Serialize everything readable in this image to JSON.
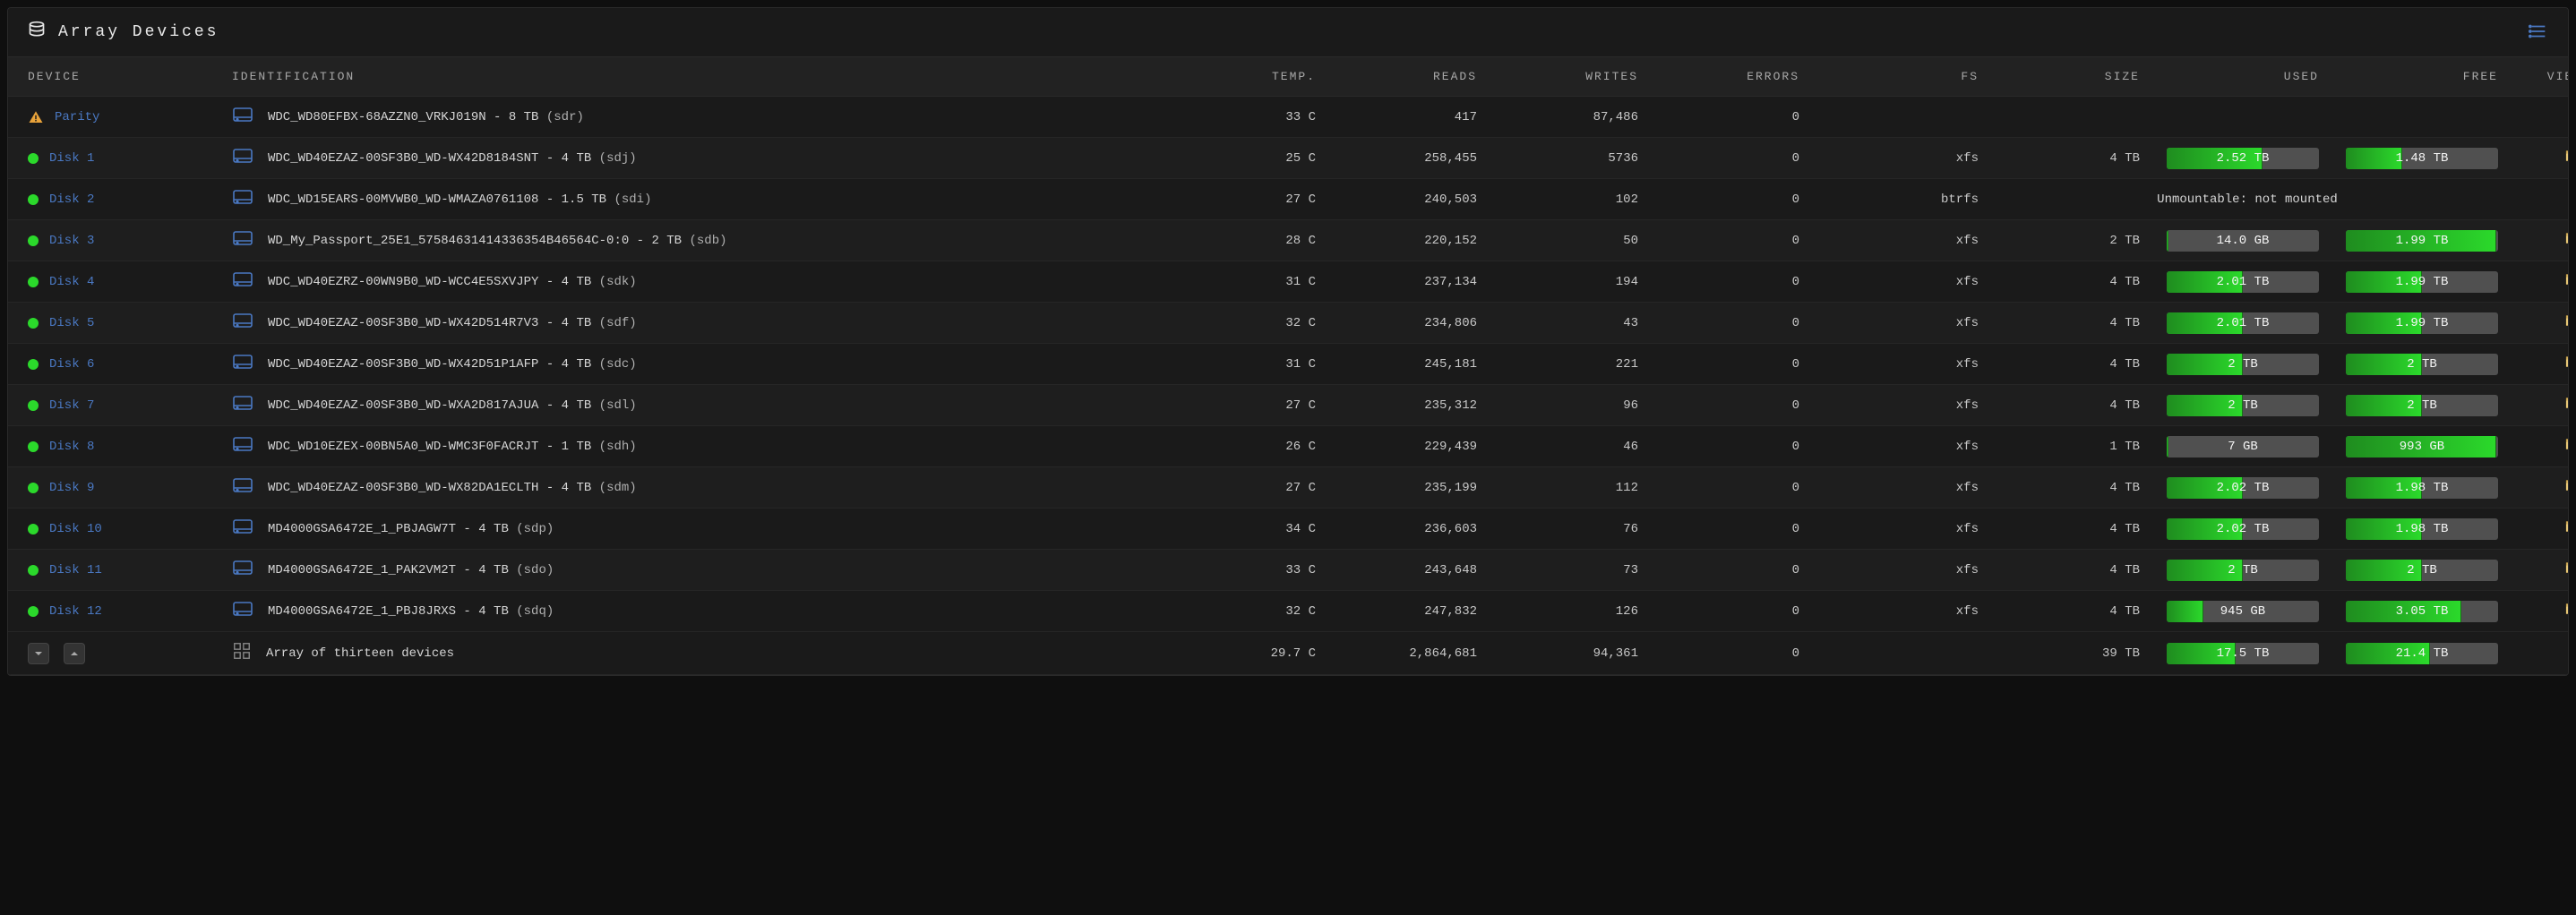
{
  "panel": {
    "title": "Array Devices"
  },
  "columns": {
    "device": "DEVICE",
    "identification": "IDENTIFICATION",
    "temp": "TEMP.",
    "reads": "READS",
    "writes": "WRITES",
    "errors": "ERRORS",
    "fs": "FS",
    "size": "SIZE",
    "used": "USED",
    "free": "FREE",
    "view": "VIEW"
  },
  "devices": [
    {
      "status": "warn",
      "name": "Parity",
      "ident": "WDC_WD80EFBX-68AZZN0_VRKJ019N",
      "cap": "8 TB",
      "node": "(sdr)",
      "temp": "33 C",
      "reads": "417",
      "writes": "87,486",
      "errors": "0",
      "fs": "",
      "size": "",
      "used": null,
      "free": null,
      "view": false,
      "unmountable": false
    },
    {
      "status": "ok",
      "name": "Disk 1",
      "ident": "WDC_WD40EZAZ-00SF3B0_WD-WX42D8184SNT",
      "cap": "4 TB",
      "node": "(sdj)",
      "temp": "25 C",
      "reads": "258,455",
      "writes": "5736",
      "errors": "0",
      "fs": "xfs",
      "size": "4 TB",
      "used": {
        "label": "2.52 TB",
        "pct": 63
      },
      "free": {
        "label": "1.48 TB",
        "pct": 37
      },
      "view": true,
      "unmountable": false
    },
    {
      "status": "ok",
      "name": "Disk 2",
      "ident": "WDC_WD15EARS-00MVWB0_WD-WMAZA0761108",
      "cap": "1.5 TB",
      "node": "(sdi)",
      "temp": "27 C",
      "reads": "240,503",
      "writes": "102",
      "errors": "0",
      "fs": "btrfs",
      "size": "",
      "used": null,
      "free": null,
      "view": false,
      "unmountable": true,
      "unmountable_text": "Unmountable: not mounted"
    },
    {
      "status": "ok",
      "name": "Disk 3",
      "ident": "WD_My_Passport_25E1_57584631414336354B46564C-0:0",
      "cap": "2 TB",
      "node": "(sdb)",
      "temp": "28 C",
      "reads": "220,152",
      "writes": "50",
      "errors": "0",
      "fs": "xfs",
      "size": "2 TB",
      "used": {
        "label": "14.0 GB",
        "pct": 1
      },
      "free": {
        "label": "1.99 TB",
        "pct": 99
      },
      "view": true,
      "unmountable": false
    },
    {
      "status": "ok",
      "name": "Disk 4",
      "ident": "WDC_WD40EZRZ-00WN9B0_WD-WCC4E5SXVJPY",
      "cap": "4 TB",
      "node": "(sdk)",
      "temp": "31 C",
      "reads": "237,134",
      "writes": "194",
      "errors": "0",
      "fs": "xfs",
      "size": "4 TB",
      "used": {
        "label": "2.01 TB",
        "pct": 50
      },
      "free": {
        "label": "1.99 TB",
        "pct": 50
      },
      "view": true,
      "unmountable": false
    },
    {
      "status": "ok",
      "name": "Disk 5",
      "ident": "WDC_WD40EZAZ-00SF3B0_WD-WX42D514R7V3",
      "cap": "4 TB",
      "node": "(sdf)",
      "temp": "32 C",
      "reads": "234,806",
      "writes": "43",
      "errors": "0",
      "fs": "xfs",
      "size": "4 TB",
      "used": {
        "label": "2.01 TB",
        "pct": 50
      },
      "free": {
        "label": "1.99 TB",
        "pct": 50
      },
      "view": true,
      "unmountable": false
    },
    {
      "status": "ok",
      "name": "Disk 6",
      "ident": "WDC_WD40EZAZ-00SF3B0_WD-WX42D51P1AFP",
      "cap": "4 TB",
      "node": "(sdc)",
      "temp": "31 C",
      "reads": "245,181",
      "writes": "221",
      "errors": "0",
      "fs": "xfs",
      "size": "4 TB",
      "used": {
        "label": "2 TB",
        "pct": 50
      },
      "free": {
        "label": "2 TB",
        "pct": 50
      },
      "view": true,
      "unmountable": false
    },
    {
      "status": "ok",
      "name": "Disk 7",
      "ident": "WDC_WD40EZAZ-00SF3B0_WD-WXA2D817AJUA",
      "cap": "4 TB",
      "node": "(sdl)",
      "temp": "27 C",
      "reads": "235,312",
      "writes": "96",
      "errors": "0",
      "fs": "xfs",
      "size": "4 TB",
      "used": {
        "label": "2 TB",
        "pct": 50
      },
      "free": {
        "label": "2 TB",
        "pct": 50
      },
      "view": true,
      "unmountable": false
    },
    {
      "status": "ok",
      "name": "Disk 8",
      "ident": "WDC_WD10EZEX-00BN5A0_WD-WMC3F0FACRJT",
      "cap": "1 TB",
      "node": "(sdh)",
      "temp": "26 C",
      "reads": "229,439",
      "writes": "46",
      "errors": "0",
      "fs": "xfs",
      "size": "1 TB",
      "used": {
        "label": "7 GB",
        "pct": 1
      },
      "free": {
        "label": "993 GB",
        "pct": 99
      },
      "view": true,
      "unmountable": false
    },
    {
      "status": "ok",
      "name": "Disk 9",
      "ident": "WDC_WD40EZAZ-00SF3B0_WD-WX82DA1ECLTH",
      "cap": "4 TB",
      "node": "(sdm)",
      "temp": "27 C",
      "reads": "235,199",
      "writes": "112",
      "errors": "0",
      "fs": "xfs",
      "size": "4 TB",
      "used": {
        "label": "2.02 TB",
        "pct": 50
      },
      "free": {
        "label": "1.98 TB",
        "pct": 50
      },
      "view": true,
      "unmountable": false
    },
    {
      "status": "ok",
      "name": "Disk 10",
      "ident": "MD4000GSA6472E_1_PBJAGW7T",
      "cap": "4 TB",
      "node": "(sdp)",
      "temp": "34 C",
      "reads": "236,603",
      "writes": "76",
      "errors": "0",
      "fs": "xfs",
      "size": "4 TB",
      "used": {
        "label": "2.02 TB",
        "pct": 50
      },
      "free": {
        "label": "1.98 TB",
        "pct": 50
      },
      "view": true,
      "unmountable": false
    },
    {
      "status": "ok",
      "name": "Disk 11",
      "ident": "MD4000GSA6472E_1_PAK2VM2T",
      "cap": "4 TB",
      "node": "(sdo)",
      "temp": "33 C",
      "reads": "243,648",
      "writes": "73",
      "errors": "0",
      "fs": "xfs",
      "size": "4 TB",
      "used": {
        "label": "2 TB",
        "pct": 50
      },
      "free": {
        "label": "2 TB",
        "pct": 50
      },
      "view": true,
      "unmountable": false
    },
    {
      "status": "ok",
      "name": "Disk 12",
      "ident": "MD4000GSA6472E_1_PBJ8JRXS",
      "cap": "4 TB",
      "node": "(sdq)",
      "temp": "32 C",
      "reads": "247,832",
      "writes": "126",
      "errors": "0",
      "fs": "xfs",
      "size": "4 TB",
      "used": {
        "label": "945 GB",
        "pct": 24
      },
      "free": {
        "label": "3.05 TB",
        "pct": 76
      },
      "view": true,
      "unmountable": false
    }
  ],
  "summary": {
    "label": "Array of thirteen devices",
    "temp": "29.7 C",
    "reads": "2,864,681",
    "writes": "94,361",
    "errors": "0",
    "fs": "",
    "size": "39 TB",
    "used": {
      "label": "17.5 TB",
      "pct": 45
    },
    "free": {
      "label": "21.4 TB",
      "pct": 55
    }
  }
}
